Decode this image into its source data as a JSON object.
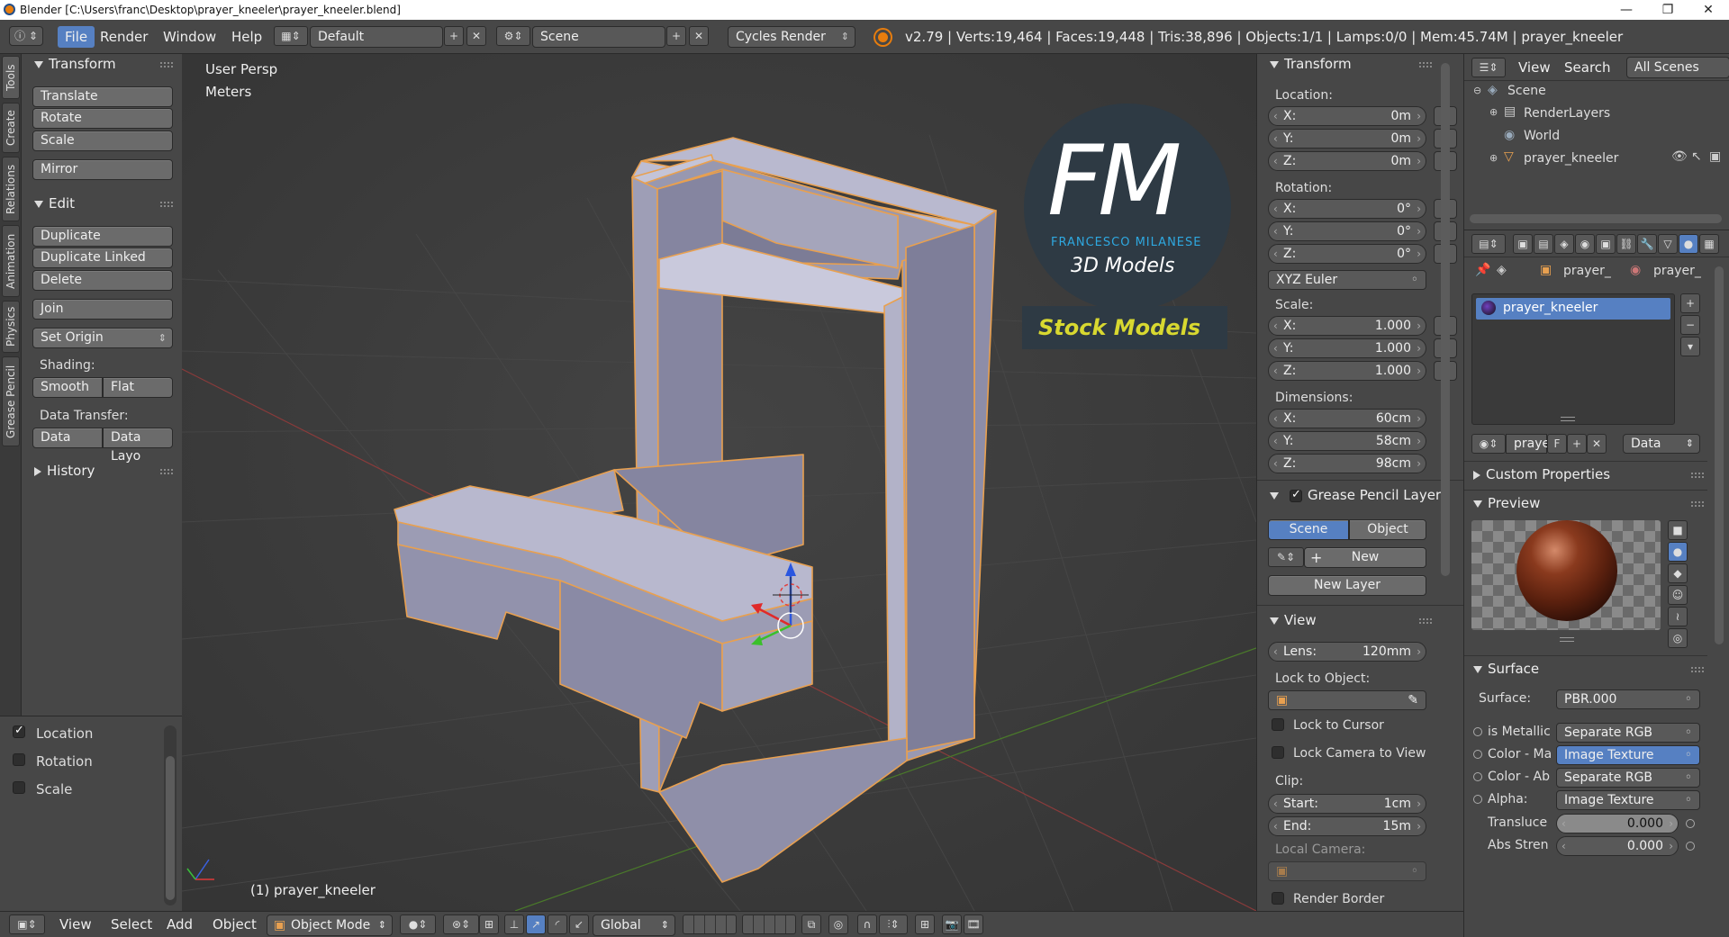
{
  "window": {
    "title": "Blender  [C:\\Users\\franc\\Desktop\\prayer_kneeler\\prayer_kneeler.blend]",
    "minimize": "—",
    "maximize": "❐",
    "close": "✕"
  },
  "menubar": {
    "items": [
      "File",
      "Render",
      "Window",
      "Help"
    ],
    "layout": "Default",
    "scene": "Scene",
    "engine": "Cycles Render",
    "stats": "v2.79 | Verts:19,464 | Faces:19,448 | Tris:38,896 | Objects:1/1 | Lamps:0/0 | Mem:45.74M | prayer_kneeler"
  },
  "tool_tabs": [
    "Tools",
    "Create",
    "Relations",
    "Animation",
    "Physics",
    "Grease Pencil"
  ],
  "tools": {
    "transform_title": "Transform",
    "translate": "Translate",
    "rotate": "Rotate",
    "scale": "Scale",
    "mirror": "Mirror",
    "edit_title": "Edit",
    "duplicate": "Duplicate",
    "duplicate_linked": "Duplicate Linked",
    "delete": "Delete",
    "join": "Join",
    "set_origin": "Set Origin",
    "shading_label": "Shading:",
    "smooth": "Smooth",
    "flat": "Flat",
    "data_transfer_label": "Data Transfer:",
    "data": "Data",
    "data_layo": "Data Layo",
    "history_title": "History"
  },
  "keying": {
    "location": "Location",
    "rotation": "Rotation",
    "scale": "Scale"
  },
  "viewport": {
    "view_label": "User Persp",
    "units": "Meters",
    "object_label": "(1) prayer_kneeler",
    "logo_fm": "FM",
    "logo_name": "FRANCESCO MILANESE",
    "logo_sub": "3D Models",
    "stock": "Stock Models"
  },
  "npanel": {
    "transform_title": "Transform",
    "location_label": "Location:",
    "location": [
      {
        "k": "X:",
        "v": "0m"
      },
      {
        "k": "Y:",
        "v": "0m"
      },
      {
        "k": "Z:",
        "v": "0m"
      }
    ],
    "rotation_label": "Rotation:",
    "rotation": [
      {
        "k": "X:",
        "v": "0°"
      },
      {
        "k": "Y:",
        "v": "0°"
      },
      {
        "k": "Z:",
        "v": "0°"
      }
    ],
    "rotation_mode": "XYZ Euler",
    "scale_label": "Scale:",
    "scale": [
      {
        "k": "X:",
        "v": "1.000"
      },
      {
        "k": "Y:",
        "v": "1.000"
      },
      {
        "k": "Z:",
        "v": "1.000"
      }
    ],
    "dimensions_label": "Dimensions:",
    "dimensions": [
      {
        "k": "X:",
        "v": "60cm"
      },
      {
        "k": "Y:",
        "v": "58cm"
      },
      {
        "k": "Z:",
        "v": "98cm"
      }
    ],
    "gp_title": "Grease Pencil Layer",
    "gp_scene": "Scene",
    "gp_object": "Object",
    "gp_new": "New",
    "gp_new_layer": "New Layer",
    "view_title": "View",
    "lens_k": "Lens:",
    "lens_v": "120mm",
    "lock_object_label": "Lock to Object:",
    "lock_cursor": "Lock to Cursor",
    "lock_camera": "Lock Camera to View",
    "clip_label": "Clip:",
    "clip_start_k": "Start:",
    "clip_start_v": "1cm",
    "clip_end_k": "End:",
    "clip_end_v": "15m",
    "local_camera_label": "Local Camera:",
    "render_border": "Render Border"
  },
  "outliner": {
    "view": "View",
    "search": "Search",
    "all_scenes": "All Scenes",
    "scene": "Scene",
    "renderlayers": "RenderLayers",
    "world": "World",
    "object": "prayer_kneeler"
  },
  "properties": {
    "crumb1": "prayer_",
    "crumb2": "prayer_",
    "material": "prayer_kneeler",
    "mat_field": "praye",
    "mat_f": "F",
    "data": "Data",
    "custom_props": "Custom Properties",
    "preview": "Preview",
    "surface_title": "Surface",
    "surface_k": "Surface:",
    "surface_v": "PBR.000",
    "inputs": [
      {
        "k": "is Metallic",
        "v": "Separate RGB"
      },
      {
        "k": "Color - Ma",
        "v": "Image Texture"
      },
      {
        "k": "Color - Ab",
        "v": "Separate RGB"
      },
      {
        "k": "Alpha:",
        "v": "Image Texture"
      }
    ],
    "transluce_k": "Transluce",
    "transluce_v": "0.000",
    "absstren_k": "Abs Stren",
    "absstren_v": "0.000"
  },
  "footer": {
    "view": "View",
    "select": "Select",
    "add": "Add",
    "object": "Object",
    "mode": "Object Mode",
    "orientation": "Global"
  },
  "colors": {
    "accent": "#5680c2",
    "selection": "#e8a050",
    "mesh": "#a7a7bd",
    "logo_blue": "#2ea8e0",
    "stock_yellow": "#d8d830"
  }
}
